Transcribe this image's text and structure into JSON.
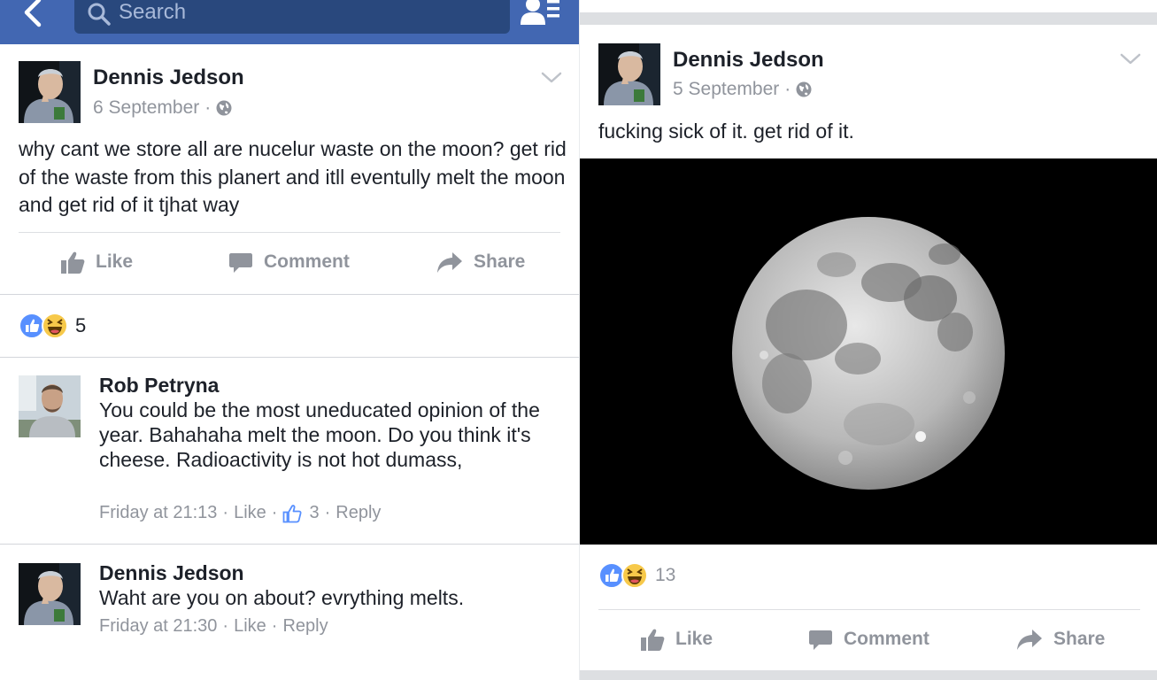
{
  "left": {
    "search": {
      "placeholder": "Search"
    },
    "post": {
      "author": "Dennis Jedson",
      "date": "6 September",
      "dot": "·",
      "text": "why cant we store all are nucelur waste on the moon? get rid of the waste from this planert and itll eventully melt the moon and get rid of it tjhat way",
      "actions": {
        "like": "Like",
        "comment": "Comment",
        "share": "Share"
      },
      "reaction_count": "5"
    },
    "comments": [
      {
        "author": "Rob Petryna",
        "text": "You could be the most uneducated opinion of the year. Bahahaha melt the moon. Do you think it's cheese. Radioactivity is not hot dumass,",
        "time": "Friday at 21:13",
        "like": "Like",
        "like_count": "3",
        "reply": "Reply",
        "sep": "·"
      },
      {
        "author": "Dennis Jedson",
        "text": "Waht are you on about? evrything melts.",
        "time": "Friday at 21:30",
        "like": "Like",
        "reply": "Reply",
        "sep": "·"
      }
    ]
  },
  "right": {
    "post": {
      "author": "Dennis Jedson",
      "date": "5 September",
      "dot": "·",
      "text": "fucking sick of it. get rid of it.",
      "reaction_count": "13",
      "actions": {
        "like": "Like",
        "comment": "Comment",
        "share": "Share"
      }
    }
  },
  "colors": {
    "brand_blue": "#4267b2",
    "search_bg": "#29487d",
    "meta_gray": "#90949c",
    "text_dark": "#1d2129",
    "like_blue": "#5890ff",
    "haha_yellow": "#f7c94a"
  },
  "icons": [
    "back-arrow-icon",
    "search-icon",
    "friend-requests-icon",
    "chevron-down-icon",
    "globe-icon",
    "like-icon",
    "comment-icon",
    "share-icon",
    "like-reaction-icon",
    "haha-reaction-icon",
    "thumbs-up-outline-icon"
  ]
}
